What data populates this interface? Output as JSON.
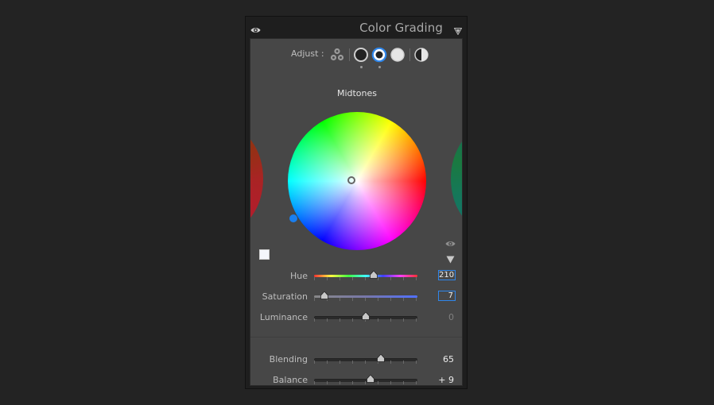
{
  "panel": {
    "title": "Color Grading",
    "header_icons": [
      "eye-icon",
      "collapse-triangle-icon"
    ]
  },
  "adjust": {
    "label": "Adjust :",
    "modes": [
      {
        "name": "3-way",
        "icon": "three-way-icon"
      },
      {
        "name": "Shadows",
        "icon": "shadows-circle-icon"
      },
      {
        "name": "Midtones",
        "icon": "midtones-circle-icon",
        "selected": true
      },
      {
        "name": "Highlights",
        "icon": "highlights-circle-icon"
      },
      {
        "name": "Global",
        "icon": "global-half-circle-icon"
      }
    ],
    "accent_color": "#2f86ea"
  },
  "mode_title": "Midtones",
  "wheel": {
    "hue": 210,
    "saturation": 7,
    "swatch_color": "#f4f6fb",
    "balance_dot_color": "#1a7ff0"
  },
  "sliders": [
    {
      "label": "Hue",
      "value": "210",
      "editing": true,
      "position": 0.58
    },
    {
      "label": "Saturation",
      "value": "7",
      "editing": true,
      "position": 0.07
    },
    {
      "label": "Luminance",
      "value": "0",
      "editing": false,
      "position": 0.5
    }
  ],
  "bottom_sliders": [
    {
      "label": "Blending",
      "value": "65",
      "position": 0.65
    },
    {
      "label": "Balance",
      "value": "+ 9",
      "position": 0.545
    }
  ]
}
